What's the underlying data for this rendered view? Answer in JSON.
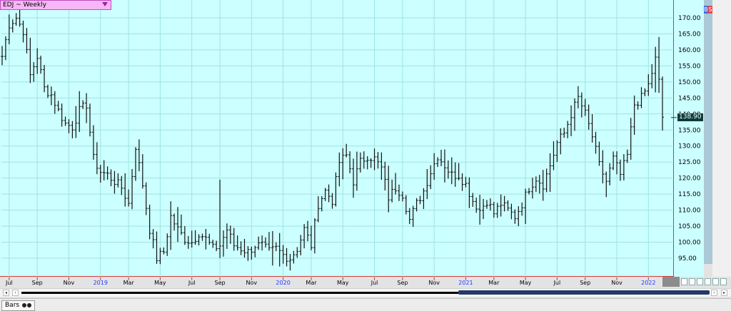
{
  "window": {
    "title": "EDJ ~ Weekly",
    "tab_label": "Bars",
    "last_price": "138.90",
    "bs_b": "B",
    "bs_s": "S"
  },
  "colors": {
    "background": "#ccffff",
    "grid": "#9fe3e3",
    "bar": "#111111",
    "axis_line": "#d63a3a",
    "title_bg": "#f7b6f7",
    "scroll_thumb": "#233a66",
    "year_label": "#1a3cff"
  },
  "chart_data": {
    "type": "ohlc",
    "title": "EDJ ~ Weekly",
    "xlabel": "",
    "ylabel": "",
    "ylim": [
      90,
      175
    ],
    "y_ticks": [
      95,
      100,
      105,
      110,
      115,
      120,
      125,
      130,
      135,
      140,
      145,
      150,
      155,
      160,
      165,
      170
    ],
    "y_tick_labels": [
      "95.00",
      "100.00",
      "105.00",
      "110.00",
      "115.00",
      "120.00",
      "125.00",
      "130.00",
      "135.00",
      "140.00",
      "145.00",
      "150.00",
      "155.00",
      "160.00",
      "165.00",
      "170.00"
    ],
    "x_labels": [
      {
        "text": "Jul",
        "year": false
      },
      {
        "text": "Sep",
        "year": false
      },
      {
        "text": "Nov",
        "year": false
      },
      {
        "text": "2019",
        "year": true
      },
      {
        "text": "Mar",
        "year": false
      },
      {
        "text": "May",
        "year": false
      },
      {
        "text": "Jul",
        "year": false
      },
      {
        "text": "Sep",
        "year": false
      },
      {
        "text": "Nov",
        "year": false
      },
      {
        "text": "2020",
        "year": true
      },
      {
        "text": "Mar",
        "year": false
      },
      {
        "text": "May",
        "year": false
      },
      {
        "text": "Jul",
        "year": false
      },
      {
        "text": "Sep",
        "year": false
      },
      {
        "text": "Nov",
        "year": false
      },
      {
        "text": "2021",
        "year": true
      },
      {
        "text": "Mar",
        "year": false
      },
      {
        "text": "May",
        "year": false
      },
      {
        "text": "Jul",
        "year": false
      },
      {
        "text": "Sep",
        "year": false
      },
      {
        "text": "Nov",
        "year": false
      },
      {
        "text": "2022",
        "year": true
      }
    ],
    "x_label_week_index": [
      2,
      10,
      19,
      28,
      36,
      45,
      54,
      62,
      71,
      80,
      88,
      97,
      106,
      114,
      123,
      132,
      140,
      149,
      158,
      166,
      175,
      184
    ],
    "series_close_anchors": [
      [
        0,
        158
      ],
      [
        2,
        168
      ],
      [
        4,
        170
      ],
      [
        6,
        166
      ],
      [
        8,
        152
      ],
      [
        10,
        158
      ],
      [
        12,
        148
      ],
      [
        14,
        146
      ],
      [
        16,
        141
      ],
      [
        18,
        137
      ],
      [
        20,
        136
      ],
      [
        22,
        141
      ],
      [
        24,
        143
      ],
      [
        26,
        126
      ],
      [
        28,
        122
      ],
      [
        30,
        121
      ],
      [
        32,
        119
      ],
      [
        34,
        117
      ],
      [
        36,
        112
      ],
      [
        38,
        130
      ],
      [
        40,
        118
      ],
      [
        42,
        104
      ],
      [
        44,
        95
      ],
      [
        46,
        97
      ],
      [
        48,
        108
      ],
      [
        50,
        104
      ],
      [
        52,
        101
      ],
      [
        54,
        100
      ],
      [
        56,
        103
      ],
      [
        58,
        101
      ],
      [
        60,
        98
      ],
      [
        62,
        99
      ],
      [
        64,
        104
      ],
      [
        66,
        99
      ],
      [
        68,
        98
      ],
      [
        70,
        97
      ],
      [
        72,
        99
      ],
      [
        74,
        99
      ],
      [
        76,
        97
      ],
      [
        78,
        98
      ],
      [
        80,
        96
      ],
      [
        82,
        95
      ],
      [
        84,
        98
      ],
      [
        86,
        104
      ],
      [
        88,
        99
      ],
      [
        90,
        112
      ],
      [
        92,
        116
      ],
      [
        94,
        113
      ],
      [
        96,
        125
      ],
      [
        98,
        127
      ],
      [
        100,
        119
      ],
      [
        102,
        125
      ],
      [
        104,
        127
      ],
      [
        106,
        126
      ],
      [
        108,
        123
      ],
      [
        110,
        114
      ],
      [
        112,
        117
      ],
      [
        114,
        115
      ],
      [
        116,
        107
      ],
      [
        118,
        112
      ],
      [
        120,
        116
      ],
      [
        122,
        122
      ],
      [
        124,
        127
      ],
      [
        126,
        124
      ],
      [
        128,
        121
      ],
      [
        130,
        121
      ],
      [
        132,
        118
      ],
      [
        134,
        113
      ],
      [
        136,
        110
      ],
      [
        138,
        113
      ],
      [
        140,
        109
      ],
      [
        142,
        112
      ],
      [
        144,
        110
      ],
      [
        146,
        108
      ],
      [
        148,
        112
      ],
      [
        150,
        117
      ],
      [
        152,
        120
      ],
      [
        154,
        118
      ],
      [
        156,
        124
      ],
      [
        158,
        131
      ],
      [
        160,
        134
      ],
      [
        162,
        140
      ],
      [
        164,
        145
      ],
      [
        166,
        140
      ],
      [
        168,
        133
      ],
      [
        170,
        124
      ],
      [
        172,
        119
      ],
      [
        174,
        126
      ],
      [
        176,
        121
      ],
      [
        178,
        127
      ],
      [
        180,
        143
      ],
      [
        182,
        145
      ],
      [
        184,
        149
      ],
      [
        186,
        157
      ],
      [
        187,
        150
      ],
      [
        188,
        139
      ]
    ],
    "week_count": 189,
    "last_price": 138.9
  }
}
